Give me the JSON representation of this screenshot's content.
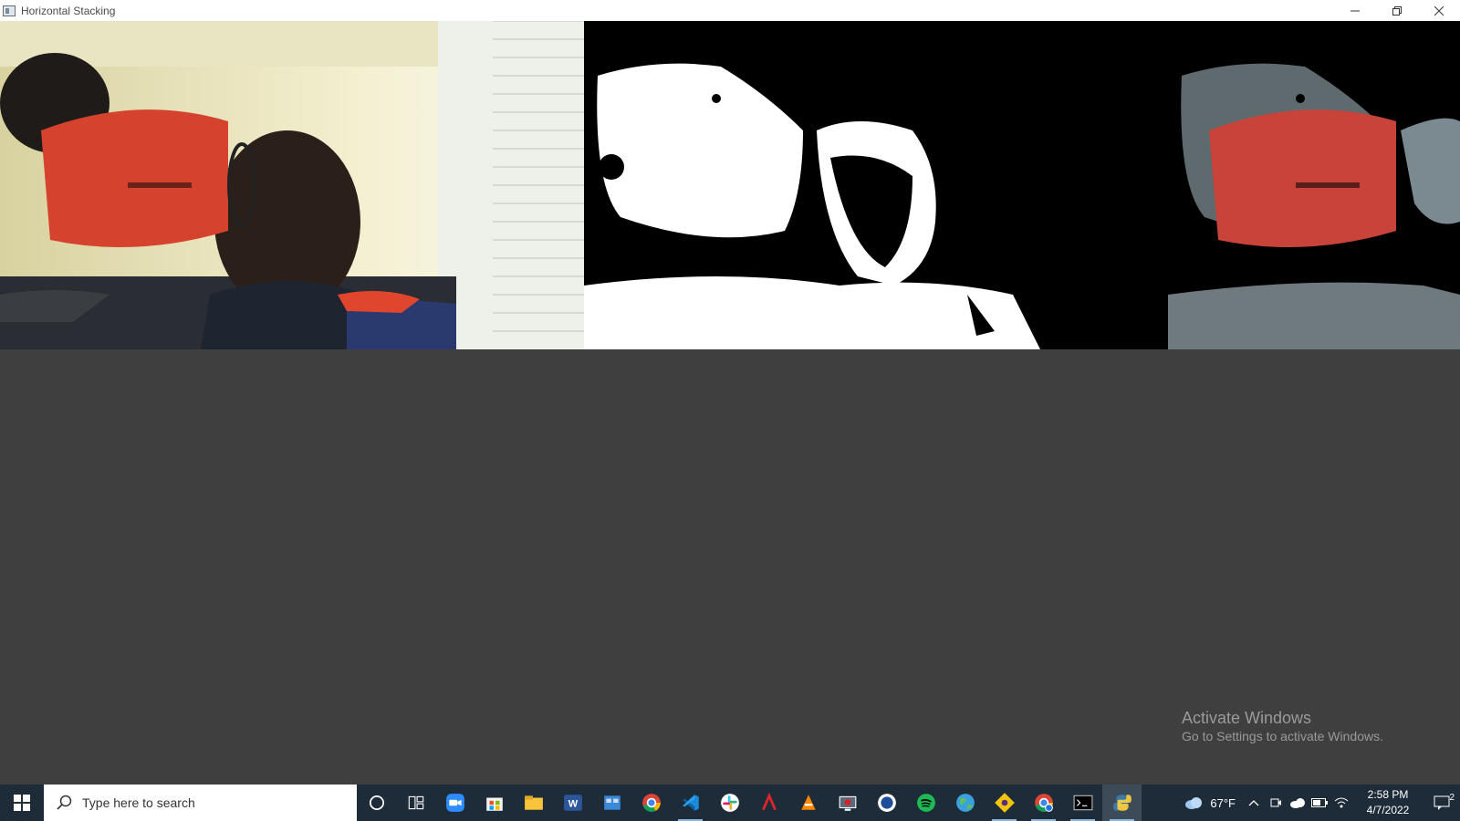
{
  "window": {
    "title": "Horizontal Stacking",
    "controls": {
      "minimize": "—",
      "restore": "❐",
      "close": "✕"
    }
  },
  "panels": [
    {
      "name": "original-frame",
      "kind": "color camera frame"
    },
    {
      "name": "mask-frame",
      "kind": "binary mask"
    },
    {
      "name": "masked-result-frame",
      "kind": "masked color frame"
    }
  ],
  "watermark": {
    "line1": "Activate Windows",
    "line2": "Go to Settings to activate Windows."
  },
  "taskbar": {
    "search_placeholder": "Type here to search",
    "apps": [
      {
        "name": "cortana-icon",
        "open": false
      },
      {
        "name": "task-view-icon",
        "open": false
      },
      {
        "name": "zoom-icon",
        "open": false
      },
      {
        "name": "store-icon",
        "open": false
      },
      {
        "name": "file-explorer-icon",
        "open": false
      },
      {
        "name": "word-icon",
        "open": false
      },
      {
        "name": "control-panel-icon",
        "open": false
      },
      {
        "name": "chrome-icon",
        "open": false
      },
      {
        "name": "vscode-icon",
        "open": true
      },
      {
        "name": "slack-icon",
        "open": false
      },
      {
        "name": "acrobat-icon",
        "open": false
      },
      {
        "name": "vlc-icon",
        "open": false
      },
      {
        "name": "screen-recorder-icon",
        "open": false
      },
      {
        "name": "app-circle-icon",
        "open": false
      },
      {
        "name": "spotify-icon",
        "open": false
      },
      {
        "name": "globe-icon",
        "open": false
      },
      {
        "name": "git-icon",
        "open": true
      },
      {
        "name": "chrome-profile-icon",
        "open": true
      },
      {
        "name": "terminal-icon",
        "open": true
      },
      {
        "name": "python-icon",
        "open": true,
        "active": true
      }
    ],
    "tray": {
      "weather": "67°F",
      "time": "2:58 PM",
      "date": "4/7/2022",
      "notifications": "2"
    }
  }
}
